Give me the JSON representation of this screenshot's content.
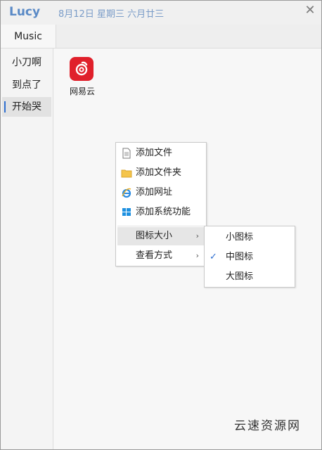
{
  "window": {
    "title": "Lucy",
    "date": "8月12日 星期三 六月廿三",
    "close_glyph": "✕"
  },
  "tabs": [
    {
      "label": "Music",
      "active": true
    }
  ],
  "sidebar": {
    "items": [
      {
        "label": "小刀啊",
        "active": false
      },
      {
        "label": "到点了",
        "active": false
      },
      {
        "label": "开始哭",
        "active": true
      }
    ]
  },
  "content": {
    "apps": [
      {
        "label": "网易云",
        "icon": "netease-music-icon",
        "color": "#e0202b"
      }
    ]
  },
  "context_menu": {
    "items": [
      {
        "label": "添加文件",
        "icon": "file-icon"
      },
      {
        "label": "添加文件夹",
        "icon": "folder-icon"
      },
      {
        "label": "添加网址",
        "icon": "ie-browser-icon"
      },
      {
        "label": "添加系统功能",
        "icon": "windows-icon"
      },
      {
        "label": "图标大小",
        "has_submenu": true,
        "highlighted": true
      },
      {
        "label": "查看方式",
        "has_submenu": true
      }
    ],
    "submenu_arrow": "›"
  },
  "icon_size_submenu": {
    "items": [
      {
        "label": "小图标",
        "checked": false
      },
      {
        "label": "中图标",
        "checked": true
      },
      {
        "label": "大图标",
        "checked": false
      }
    ],
    "check_glyph": "✓"
  },
  "watermark": "云速资源网",
  "colors": {
    "title": "#5a8ac6",
    "accent": "#2f6fd0",
    "app_red": "#e0202b"
  }
}
